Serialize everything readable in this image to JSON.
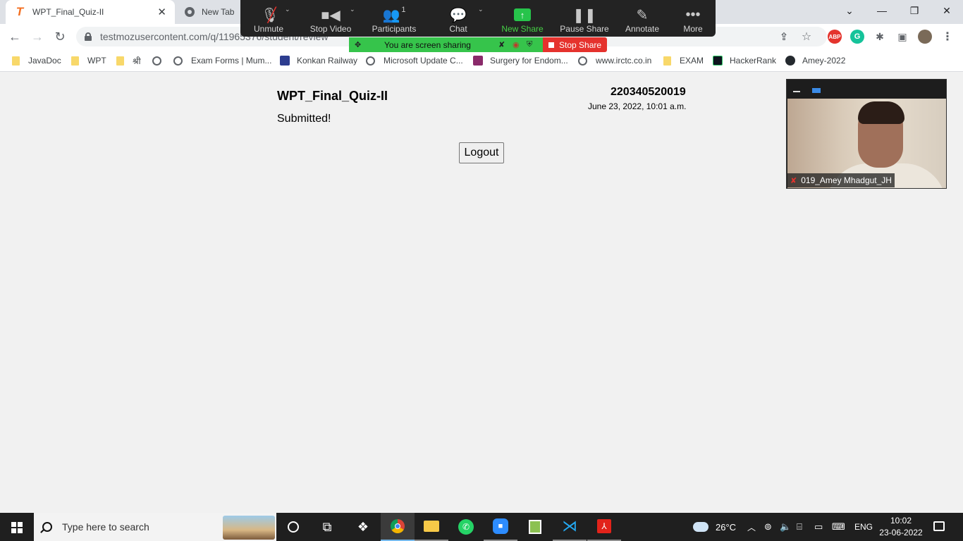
{
  "browser": {
    "tabs": [
      {
        "title": "WPT_Final_Quiz-II",
        "icon": "testmoz-icon"
      },
      {
        "title": "New Tab",
        "icon": "chrome-icon"
      }
    ],
    "url": "testmozusercontent.com/q/11965376/student/review",
    "bookmarks": [
      {
        "label": "JavaDoc",
        "icon": "folder-icon"
      },
      {
        "label": "WPT",
        "icon": "folder-icon"
      },
      {
        "label": "श्री",
        "icon": "folder-icon"
      },
      {
        "label": "Exam Forms | Mum...",
        "icon": "globe-icon"
      },
      {
        "label": "Konkan Railway",
        "icon": "railway-icon"
      },
      {
        "label": "Microsoft Update C...",
        "icon": "globe-icon"
      },
      {
        "label": "Surgery for Endom...",
        "icon": "site-icon"
      },
      {
        "label": "www.irctc.co.in",
        "icon": "globe-icon"
      },
      {
        "label": "EXAM",
        "icon": "folder-icon"
      },
      {
        "label": "HackerRank",
        "icon": "hackerrank-icon"
      },
      {
        "label": "Amey-2022",
        "icon": "github-icon"
      }
    ],
    "extensions": [
      "ABP",
      "G"
    ]
  },
  "zoom": {
    "controls": [
      {
        "label": "Unmute",
        "icon": "muted-mic-icon"
      },
      {
        "label": "Stop Video",
        "icon": "video-camera-icon"
      },
      {
        "label": "Participants",
        "icon": "participants-icon",
        "count": "1"
      },
      {
        "label": "Chat",
        "icon": "chat-icon"
      },
      {
        "label": "New Share",
        "icon": "share-up-arrow-icon"
      },
      {
        "label": "Pause Share",
        "icon": "pause-icon"
      },
      {
        "label": "Annotate",
        "icon": "pencil-icon"
      },
      {
        "label": "More",
        "icon": "more-dots-icon"
      }
    ],
    "sharing_text": "You are screen sharing",
    "stop_share": "Stop Share",
    "participant_name": "019_Amey Mhadgut_JH",
    "colors": {
      "share_green": "#36c44b",
      "stop_red": "#e5322d"
    }
  },
  "page": {
    "quiz_title": "WPT_Final_Quiz-II",
    "student_id": "220340520019",
    "timestamp": "June 23, 2022, 10:01 a.m.",
    "status": "Submitted!",
    "logout_label": "Logout"
  },
  "taskbar": {
    "search_placeholder": "Type here to search",
    "weather": "26°C",
    "language": "ENG",
    "time": "10:02",
    "date": "23-06-2022"
  }
}
